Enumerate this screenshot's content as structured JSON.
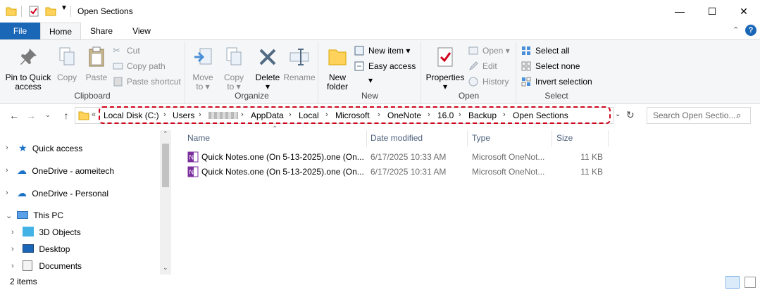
{
  "window": {
    "title": "Open Sections"
  },
  "tabs": [
    {
      "label": "File"
    },
    {
      "label": "Home"
    },
    {
      "label": "Share"
    },
    {
      "label": "View"
    }
  ],
  "ribbon": {
    "clipboard": {
      "group_label": "Clipboard",
      "pin_label_1": "Pin to Quick",
      "pin_label_2": "access",
      "copy": "Copy",
      "paste": "Paste",
      "cut": "Cut",
      "copy_path": "Copy path",
      "paste_shortcut": "Paste shortcut"
    },
    "organize": {
      "group_label": "Organize",
      "move_to_1": "Move",
      "move_to_2": "to",
      "copy_to_1": "Copy",
      "copy_to_2": "to",
      "delete": "Delete",
      "rename": "Rename"
    },
    "new": {
      "group_label": "New",
      "new_folder_1": "New",
      "new_folder_2": "folder",
      "new_item": "New item",
      "easy_access": "Easy access"
    },
    "open": {
      "group_label": "Open",
      "properties": "Properties",
      "open": "Open",
      "edit": "Edit",
      "history": "History"
    },
    "select": {
      "group_label": "Select",
      "select_all": "Select all",
      "select_none": "Select none",
      "invert_selection": "Invert selection"
    }
  },
  "address": {
    "overflow": "«",
    "crumbs": [
      "Local Disk (C:)",
      "Users",
      "",
      "AppData",
      "Local",
      "Microsoft",
      "OneNote",
      "16.0",
      "Backup",
      "Open Sections"
    ],
    "search_placeholder": "Search Open Sectio..."
  },
  "sidebar": {
    "items": [
      {
        "label": "Quick access"
      },
      {
        "label": "OneDrive - aomeitech"
      },
      {
        "label": "OneDrive - Personal"
      },
      {
        "label": "This PC"
      },
      {
        "label": "3D Objects"
      },
      {
        "label": "Desktop"
      },
      {
        "label": "Documents"
      }
    ]
  },
  "filelist": {
    "columns": [
      "Name",
      "Date modified",
      "Type",
      "Size"
    ],
    "rows": [
      {
        "name": "Quick Notes.one (On 5-13-2025).one (On...",
        "date": "6/17/2025 10:33 AM",
        "type": "Microsoft OneNot...",
        "size": "11 KB"
      },
      {
        "name": "Quick Notes.one (On 5-13-2025).one (On...",
        "date": "6/17/2025 10:31 AM",
        "type": "Microsoft OneNot...",
        "size": "11 KB"
      }
    ]
  },
  "status": {
    "count": "2 items"
  },
  "colors": {
    "accent": "#1a67b8",
    "highlight": "#d0021b",
    "onenote": "#7b2f9d"
  }
}
